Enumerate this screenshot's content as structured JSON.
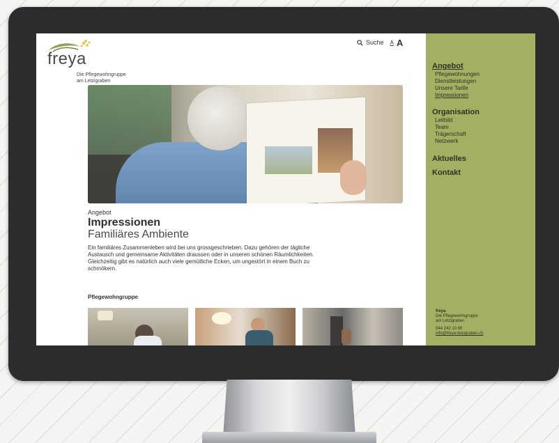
{
  "brand": {
    "logo_word": "freya",
    "tagline_line1": "Die Pflegewohngruppe",
    "tagline_line2": "am Letzigraben",
    "accent_color": "#a2b064"
  },
  "tools": {
    "search_label": "Suche",
    "font_small": "A",
    "font_large": "A"
  },
  "page": {
    "kicker": "Angebot",
    "title": "Impressionen",
    "subtitle": "Familiäres Ambiente",
    "intro": "Ein familiäres Zusammenleben wird bei uns grossgeschrieben. Dazu gehören der tägliche Austausch und gemeinsame Aktivitäten draussen oder in unseren schönen Räumlichkeiten. Gleichzeitig gibt es natürlich auch viele gemütliche Ecken, um ungestört in einem Buch zu schmökern.",
    "section_heading": "Pflegewohngruppe"
  },
  "nav": [
    {
      "label": "Angebot",
      "active": true,
      "items": [
        {
          "label": "Pflegewohnungen"
        },
        {
          "label": "Dienstleistungen"
        },
        {
          "label": "Unsere Tarife"
        },
        {
          "label": "Impressionen",
          "active": true
        }
      ]
    },
    {
      "label": "Organisation",
      "items": [
        {
          "label": "Leitbild"
        },
        {
          "label": "Team"
        },
        {
          "label": "Trägerschaft"
        },
        {
          "label": "Netzwerk"
        }
      ]
    },
    {
      "label": "Aktuelles",
      "items": []
    },
    {
      "label": "Kontakt",
      "items": []
    }
  ],
  "footer": {
    "name": "freya",
    "line1": "Die Pflegewohngruppe",
    "line2": "am Letzigraben",
    "phone": "044 242 10 90",
    "email": "info@freya-letzigraben.ch"
  },
  "icons": {
    "search": "search-icon",
    "logo": "freya-leaf-logo"
  }
}
